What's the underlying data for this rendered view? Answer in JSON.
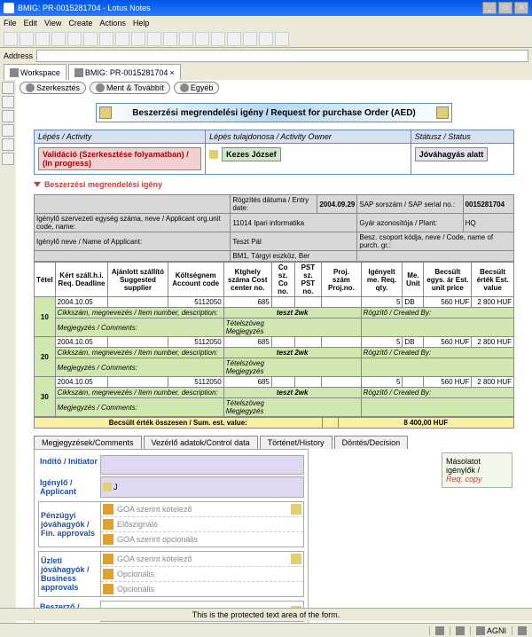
{
  "window": {
    "title": "BMIG: PR-0015281704 - Lotus Notes",
    "min": "_",
    "max": "□",
    "close": "×"
  },
  "menu": [
    "File",
    "Edit",
    "View",
    "Create",
    "Actions",
    "Help"
  ],
  "address_label": "Address",
  "tabs": {
    "workspace": "Workspace",
    "doc": "BMIG: PR-0015281704",
    "close": "×"
  },
  "action_tabs": {
    "edit": "Szerkesztés",
    "save": "Ment & Továbbít",
    "other": "Egyéb"
  },
  "form_title": "Beszerzési megrendelési igény / Request for purchase Order (AED)",
  "header": {
    "step_label": "Lépés / Activity",
    "owner_label": "Lépés tulajdonosa / Activity Owner",
    "status_label": "Státusz / Status",
    "step_value": "Validáció (Szerkesztése folyamatban) / (In progress)",
    "owner_value": "Kezes József",
    "status_value": "Jóváhagyás alatt"
  },
  "section_title": "Beszerzési megrendelési igény",
  "info": {
    "entry_date_label": "Rögzítés dátuma / Entry date:",
    "entry_date": "2004.09.29",
    "sap_label": "SAP sorszám / SAP serial no.:",
    "sap": "0015281704",
    "org_label": "Igénylő szervezeti egység száma, neve / Applicant org.unit code, name:",
    "org": "11014 Ipari informatika",
    "plant_label": "Gyár azonosítója / Plant:",
    "plant": "HQ",
    "applicant_label": "Igénylő neve / Name of Applicant:",
    "applicant": "Teszt Pál",
    "purch_label": "Besz. csoport kódja, neve / Code, name of purch. gr.:",
    "purch": "BM1, Tárgyi eszköz, Ber"
  },
  "th": {
    "tetel": "Tétel",
    "deadline": "Kért száll.h.i. Req. Deadline",
    "supplier": "Ajánlott szállító Suggested supplier",
    "account": "Költségnem Account code",
    "cost": "Ktghely száma Cost center no.",
    "co": "Co sz. Co no.",
    "pst": "PST sz. PST no.",
    "proj": "Proj. szám Proj.no.",
    "qty": "Igényelt me. Req. qty.",
    "unit": "Me. Unit",
    "unitprice": "Becsült egys. ár Est. unit price",
    "value": "Becsült érték Est. value"
  },
  "rows": [
    {
      "num": "10",
      "date": "2004.10.05",
      "acct": "5112050",
      "cost": "685",
      "qty": "5",
      "unit": "DB",
      "price": "560 HUF",
      "val": "2 800 HUF"
    },
    {
      "num": "20",
      "date": "2004.10.05",
      "acct": "5112050",
      "cost": "685",
      "qty": "5",
      "unit": "DB",
      "price": "560 HUF",
      "val": "2 800 HUF"
    },
    {
      "num": "30",
      "date": "2004.10.05",
      "acct": "5112050",
      "cost": "685",
      "qty": "5",
      "unit": "",
      "price": "560 HUF",
      "val": "2 800 HUF"
    }
  ],
  "row_labels": {
    "item_desc": "Cikkszám, megnevezés / Item number, description:",
    "item_val": "teszt 2wk",
    "created": "Rögzítő / Created By:",
    "comments": "Megjegyzés / Comments:",
    "text": "Tételszöveg",
    "text2": "Megjegyzés"
  },
  "total": {
    "label": "Becsült érték összesen / Sum. est. value:",
    "value": "8 400,00 HUF"
  },
  "comment_tabs": [
    "Megjegyzések/Comments",
    "Vezérlő adatok/Control data",
    "Történet/History",
    "Döntés/Decision"
  ],
  "approvers": {
    "initiator": "Indító / Initiator",
    "applicant": "Igénylő / Applicant",
    "fin": "Pénzügyi jóváhagyók / Fin. approvals",
    "biz": "Üzleti jóváhagyók / Business approvals",
    "purchaser": "Beszerző / Purchaser",
    "goa_mand": "GOA szerint kötelező",
    "presign": "Előszignáló",
    "goa_opt": "GOA szerint opcionális",
    "optional": "Opcionális",
    "cursor": "J"
  },
  "side": {
    "l1": "Másolatot igénylők /",
    "l2": "Req. copy"
  },
  "footer": "This is the protected text area of the form.",
  "status": {
    "agni": "AGNI"
  }
}
